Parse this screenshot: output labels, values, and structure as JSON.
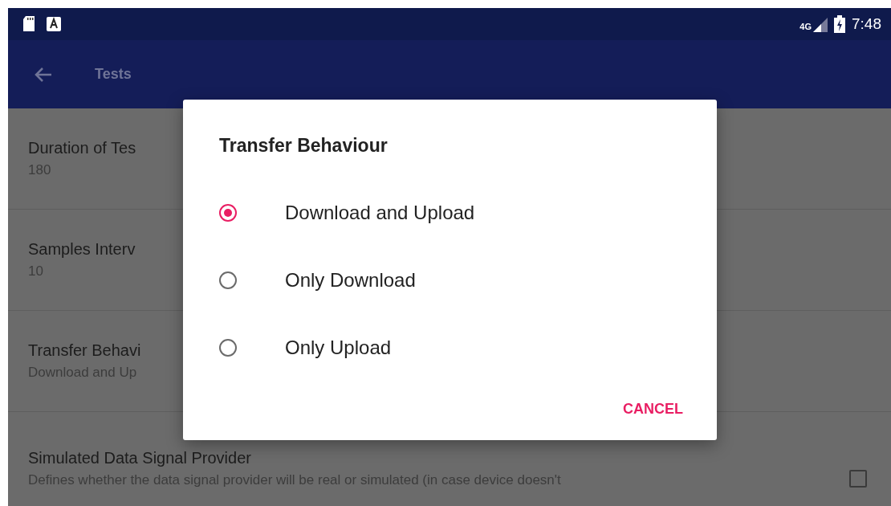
{
  "status_bar": {
    "network": "4G",
    "time": "7:48"
  },
  "app_bar": {
    "title": "Tests"
  },
  "settings": [
    {
      "kind": "value",
      "title": "Duration of Tes",
      "value": "180"
    },
    {
      "kind": "value",
      "title": "Samples Interv",
      "value": "10"
    },
    {
      "kind": "value",
      "title": "Transfer Behavi",
      "value": "Download and Up"
    },
    {
      "kind": "checkbox",
      "title": "Simulated Data Signal Provider",
      "value": "Defines whether the data signal provider will be real or simulated (in case device doesn't",
      "checked": false
    }
  ],
  "dialog": {
    "title": "Transfer Behaviour",
    "options": [
      {
        "label": "Download and Upload",
        "selected": true
      },
      {
        "label": "Only Download",
        "selected": false
      },
      {
        "label": "Only Upload",
        "selected": false
      }
    ],
    "buttons": [
      "CANCEL"
    ]
  }
}
